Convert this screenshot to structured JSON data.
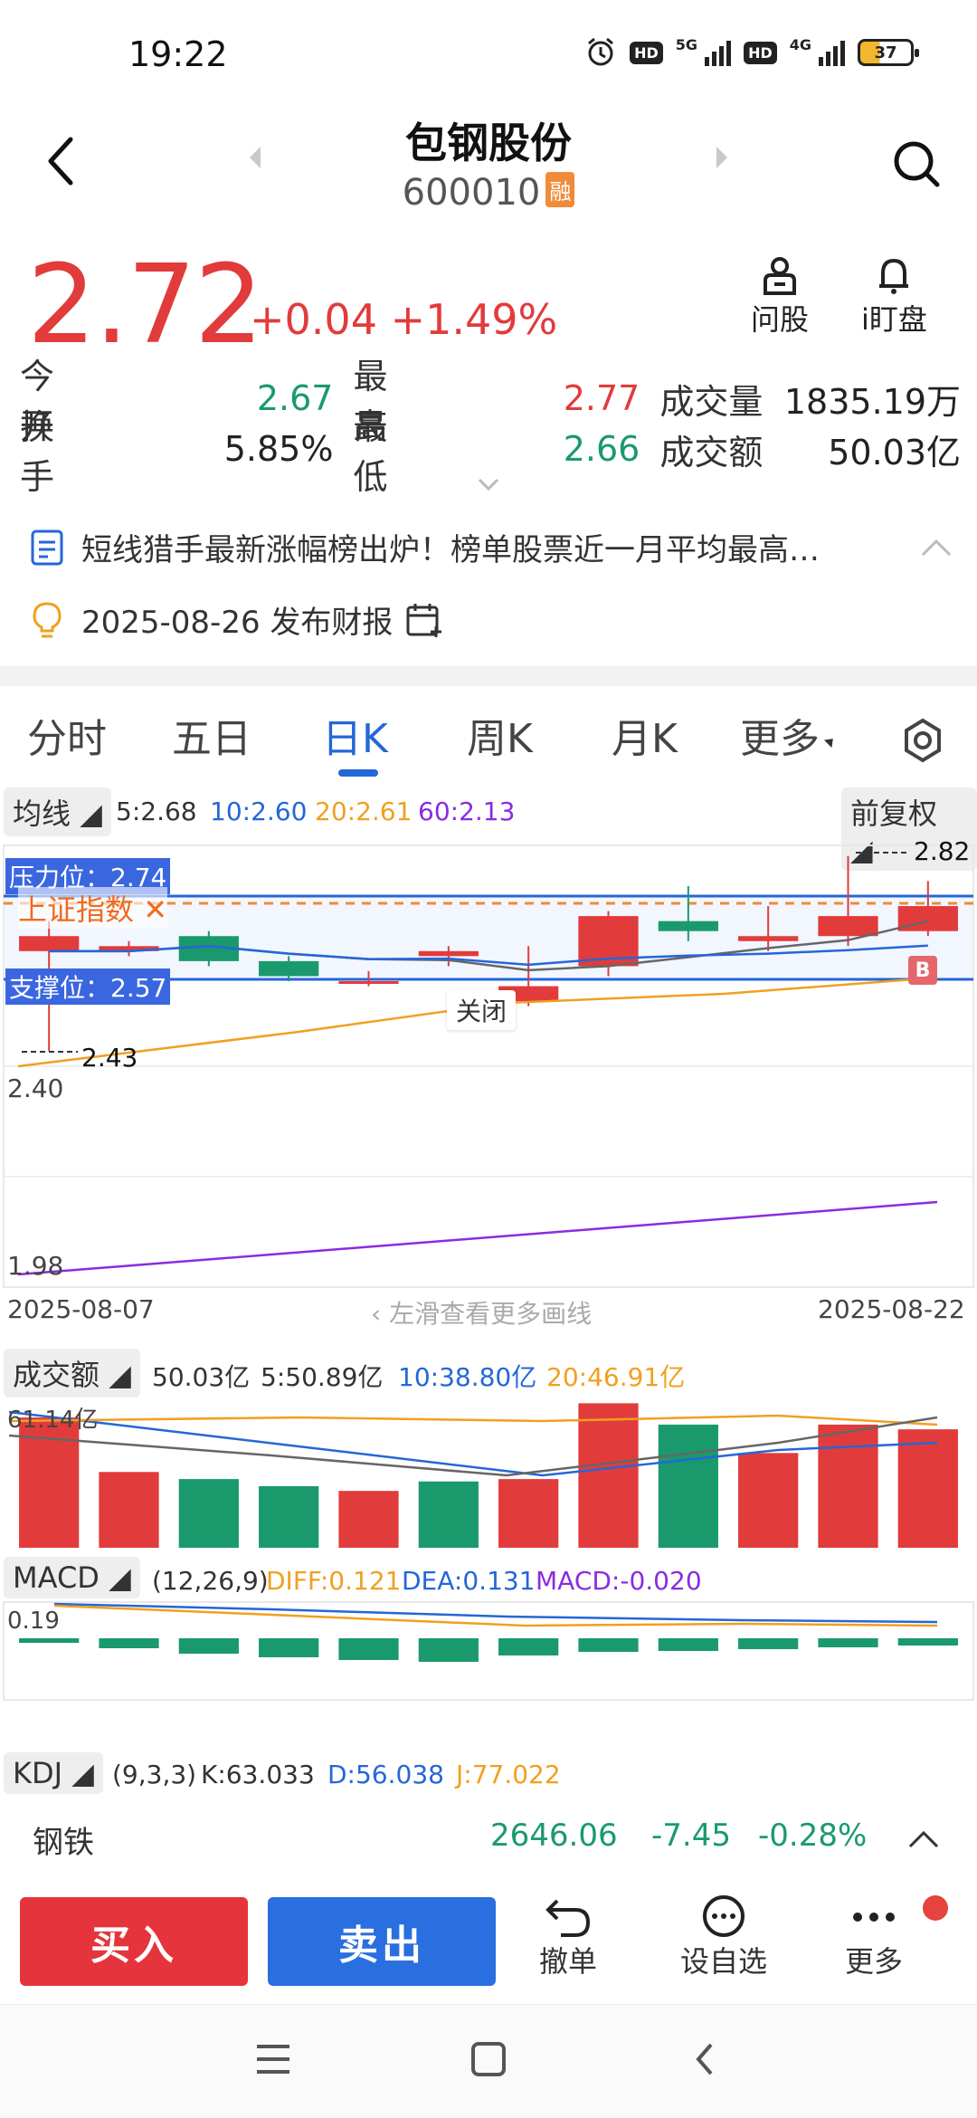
{
  "status": {
    "time": "19:22",
    "hd1": "HD",
    "net1": "5G",
    "hd2": "HD",
    "net2": "4G",
    "battery": "37"
  },
  "header": {
    "name": "包钢股份",
    "code": "600010",
    "badge": "融"
  },
  "quote": {
    "price": "2.72",
    "change": "+0.04",
    "change_pct": "+1.49%"
  },
  "actions_top": {
    "ask": "问股",
    "watch": "i盯盘"
  },
  "metrics": {
    "open_label": "今开",
    "open": "2.67",
    "high_label": "最高",
    "high": "2.77",
    "volume_label": "成交量",
    "volume": "1835.19万",
    "turnover_label": "换手",
    "turnover": "5.85%",
    "low_label": "最低",
    "low": "2.66",
    "amount_label": "成交额",
    "amount": "50.03亿"
  },
  "news": {
    "headline": "短线猎手最新涨幅榜出炉！榜单股票近一月平均最高…",
    "event": "2025-08-26 发布财报"
  },
  "tabs": [
    "分时",
    "五日",
    "日K",
    "周K",
    "月K",
    "更多"
  ],
  "ma": {
    "label": "均线",
    "ma5": "5:2.68",
    "ma10": "10:2.60",
    "ma20": "20:2.61",
    "ma60": "60:2.13",
    "adjust": "前复权"
  },
  "chart_data": {
    "type": "candlestick",
    "x_start": "2025-08-07",
    "x_end": "2025-08-22",
    "y_labels": [
      "2.40",
      "1.98"
    ],
    "resistance": "压力位：2.74",
    "support": "支撑位：2.57",
    "index_tag": "上证指数",
    "close_tag": "关闭",
    "max_mark": "2.82",
    "min_mark": "2.43",
    "hint": "左滑查看更多画线",
    "candles": [
      {
        "o": 2.66,
        "c": 2.63,
        "h": 2.69,
        "l": 2.43,
        "color": "red"
      },
      {
        "o": 2.64,
        "c": 2.63,
        "h": 2.65,
        "l": 2.62,
        "color": "red"
      },
      {
        "o": 2.61,
        "c": 2.66,
        "h": 2.67,
        "l": 2.6,
        "color": "green"
      },
      {
        "o": 2.61,
        "c": 2.58,
        "h": 2.62,
        "l": 2.57,
        "color": "green"
      },
      {
        "o": 2.57,
        "c": 2.57,
        "h": 2.59,
        "l": 2.56,
        "color": "red"
      },
      {
        "o": 2.63,
        "c": 2.62,
        "h": 2.64,
        "l": 2.6,
        "color": "red"
      },
      {
        "o": 2.56,
        "c": 2.53,
        "h": 2.64,
        "l": 2.52,
        "color": "red"
      },
      {
        "o": 2.6,
        "c": 2.7,
        "h": 2.71,
        "l": 2.58,
        "color": "red"
      },
      {
        "o": 2.69,
        "c": 2.67,
        "h": 2.76,
        "l": 2.65,
        "color": "green"
      },
      {
        "o": 2.65,
        "c": 2.66,
        "h": 2.72,
        "l": 2.63,
        "color": "red"
      },
      {
        "o": 2.66,
        "c": 2.7,
        "h": 2.82,
        "l": 2.64,
        "color": "red"
      },
      {
        "o": 2.67,
        "c": 2.72,
        "h": 2.77,
        "l": 2.66,
        "color": "red"
      }
    ],
    "volume": {
      "label": "成交额",
      "value": "50.03亿",
      "ma5": "5:50.89亿",
      "ma10": "10:38.80亿",
      "ma20": "20:46.91亿",
      "top_label": "61.14亿",
      "bars": [
        {
          "v": 55,
          "color": "red"
        },
        {
          "v": 32,
          "color": "red"
        },
        {
          "v": 29,
          "color": "green"
        },
        {
          "v": 26,
          "color": "green"
        },
        {
          "v": 24,
          "color": "red"
        },
        {
          "v": 28,
          "color": "green"
        },
        {
          "v": 29,
          "color": "red"
        },
        {
          "v": 61,
          "color": "red"
        },
        {
          "v": 52,
          "color": "green"
        },
        {
          "v": 40,
          "color": "red"
        },
        {
          "v": 52,
          "color": "red"
        },
        {
          "v": 50,
          "color": "red"
        }
      ]
    },
    "macd": {
      "label": "MACD",
      "params": "(12,26,9)",
      "diff": "DIFF:0.121",
      "dea": "DEA:0.131",
      "macd": "MACD:-0.020",
      "top_label": "0.19",
      "bars": [
        -0.005,
        -0.011,
        -0.017,
        -0.021,
        -0.024,
        -0.026,
        -0.019,
        -0.015,
        -0.014,
        -0.012,
        -0.01,
        -0.008
      ]
    },
    "kdj": {
      "label": "KDJ",
      "params": "(9,3,3)",
      "k": "K:63.033",
      "d": "D:56.038",
      "j": "J:77.022"
    }
  },
  "sector": {
    "name": "钢铁",
    "value": "2646.06",
    "change": "-7.45",
    "pct": "-0.28%"
  },
  "bottom": {
    "buy": "买入",
    "sell": "卖出",
    "cancel": "撤单",
    "fav": "设自选",
    "more": "更多"
  },
  "colors": {
    "up": "#e23b3b",
    "down": "#1a9a6c",
    "accent": "#2467d7"
  }
}
